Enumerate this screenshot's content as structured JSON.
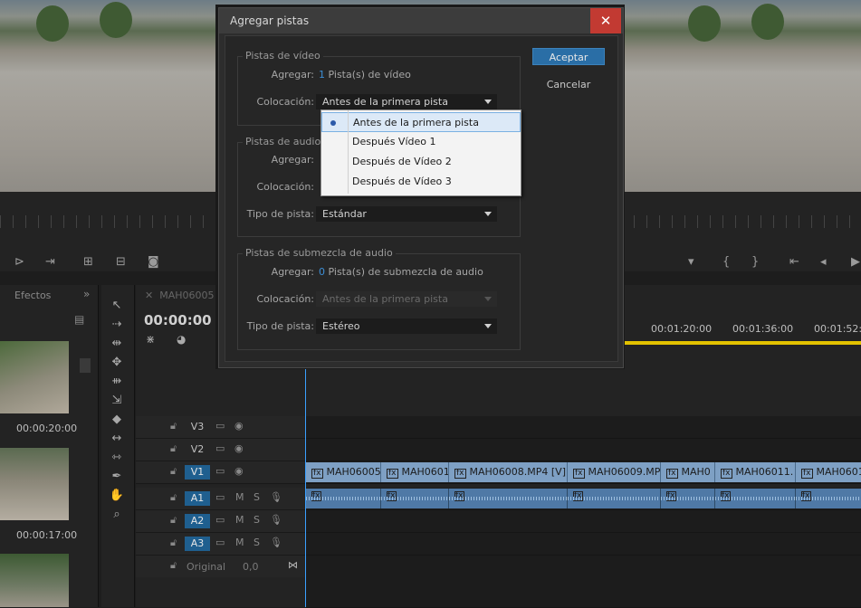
{
  "dialog": {
    "title": "Agregar pistas",
    "close_label": "✕",
    "buttons": {
      "ok": "Aceptar",
      "cancel": "Cancelar"
    },
    "video_group": {
      "title": "Pistas de vídeo",
      "add_label": "Agregar:",
      "add_count": "1",
      "add_suffix": "Pista(s) de vídeo",
      "placement_label": "Colocación:",
      "placement_value": "Antes de la primera pista"
    },
    "audio_group": {
      "title": "Pistas de audio",
      "add_label": "Agregar:",
      "placement_label": "Colocación:",
      "type_label": "Tipo de pista:",
      "type_value": "Estándar"
    },
    "submix_group": {
      "title": "Pistas de submezcla de audio",
      "add_label": "Agregar:",
      "add_count": "0",
      "add_suffix": "Pista(s) de submezcla de audio",
      "placement_label": "Colocación:",
      "placement_value": "Antes de la primera pista",
      "type_label": "Tipo de pista:",
      "type_value": "Estéreo"
    },
    "dropdown": {
      "options": [
        "Antes de la primera pista",
        "Después Vídeo 1",
        "Después de Vídeo 2",
        "Después de Vídeo 3"
      ],
      "selected_index": 0
    }
  },
  "effects_panel": {
    "tab": "Efectos",
    "thumb_times": [
      "00:00:20:00",
      "00:00:17:00"
    ]
  },
  "timeline": {
    "sequence_tab": "MAH06005",
    "current_time": "00:00:00",
    "time_labels": [
      "00:01:20:00",
      "00:01:36:00",
      "00:01:52:00"
    ],
    "tracks": {
      "video": [
        "V3",
        "V2",
        "V1"
      ],
      "audio": [
        "A1",
        "A2",
        "A3"
      ],
      "master_label": "Original",
      "master_value": "0,0",
      "toggle_m": "M",
      "toggle_s": "S"
    },
    "clips": [
      "MAH06005",
      "MAH0601",
      "MAH06008.MP4 [V]",
      "MAH06009.MP",
      "MAH0",
      "MAH06011.",
      "MAH0601"
    ],
    "fx_badge": "fx"
  },
  "colors": {
    "accent": "#2a6ea6",
    "close": "#c23a32",
    "work_area": "#e3c200",
    "clip_video": "#7ea0c4",
    "clip_audio": "#4f79a6"
  }
}
